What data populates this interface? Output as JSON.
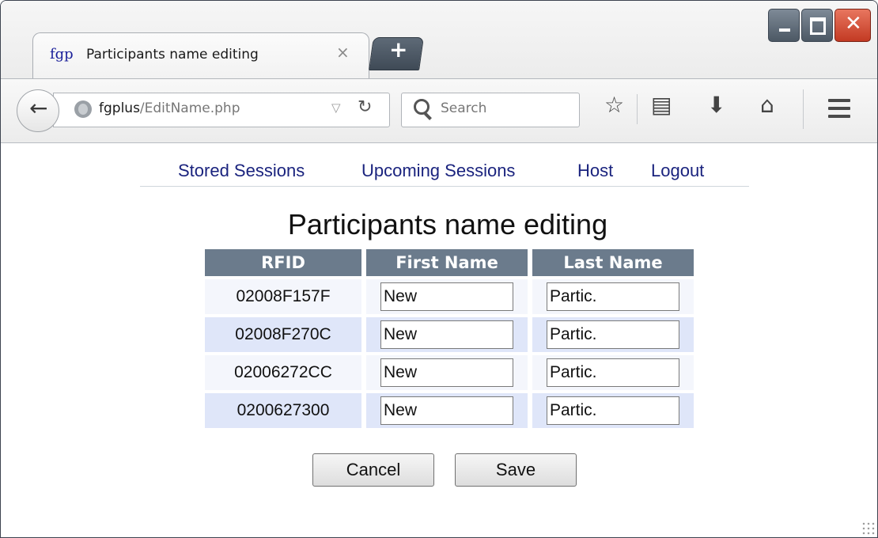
{
  "browser": {
    "tab": {
      "favicon_text": "fgp",
      "title": "Participants name editing",
      "close_glyph": "×"
    },
    "new_tab_glyph": "+",
    "window_controls": {
      "close_glyph": "✕"
    },
    "url": {
      "host": "fgplus",
      "path": "/EditName.php"
    },
    "search_placeholder": "Search",
    "icons": {
      "back": "←",
      "dropmark": "▽",
      "reload": "↻",
      "bookmark": "☆",
      "reading_list": "▤",
      "download": "⬇",
      "home": "⌂"
    }
  },
  "nav": {
    "stored_sessions": "Stored Sessions",
    "upcoming_sessions": "Upcoming Sessions",
    "host": "Host",
    "logout": "Logout"
  },
  "page": {
    "title": "Participants name editing",
    "columns": {
      "rfid": "RFID",
      "first_name": "First Name",
      "last_name": "Last Name"
    },
    "rows": [
      {
        "rfid": "02008F157F",
        "first_name": "New",
        "last_name": "Partic."
      },
      {
        "rfid": "02008F270C",
        "first_name": "New",
        "last_name": "Partic."
      },
      {
        "rfid": "02006272CC",
        "first_name": "New",
        "last_name": "Partic."
      },
      {
        "rfid": "0200627300",
        "first_name": "New",
        "last_name": "Partic."
      }
    ],
    "buttons": {
      "cancel": "Cancel",
      "save": "Save"
    }
  },
  "colors": {
    "header_bg": "#6b7b8c",
    "row_light": "#f4f6fc",
    "row_dark": "#dfe6f9",
    "link": "#1a237e",
    "close_button": "#c33a23"
  }
}
